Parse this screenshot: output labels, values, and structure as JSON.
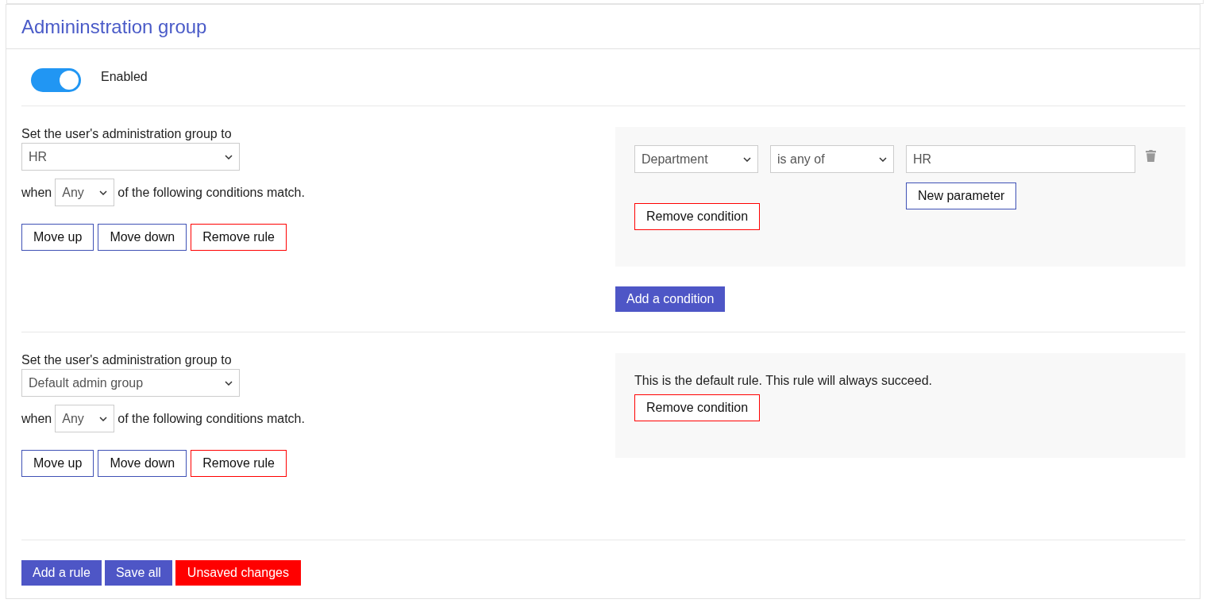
{
  "panel": {
    "title": "Admininstration group"
  },
  "enabled": {
    "label": "Enabled",
    "on": true
  },
  "rules": [
    {
      "kind": "conditions",
      "set_label": "Set the user's administration group to",
      "group": "HR",
      "when_label": "when",
      "match": "Any",
      "match_suffix": "of the following conditions match.",
      "buttons": {
        "move_up": "Move up",
        "move_down": "Move down",
        "remove": "Remove rule"
      },
      "conditions": [
        {
          "field": "Department",
          "operator": "is any of",
          "parameters": [
            "HR"
          ],
          "new_parameter": "New parameter",
          "remove": "Remove condition"
        }
      ],
      "add_condition": "Add a condition"
    },
    {
      "kind": "default",
      "set_label": "Set the user's administration group to",
      "group": "Default admin group",
      "when_label": "when",
      "match": "Any",
      "match_suffix": "of the following conditions match.",
      "buttons": {
        "move_up": "Move up",
        "move_down": "Move down",
        "remove": "Remove rule"
      },
      "default_text": "This is the default rule. This rule will always succeed.",
      "remove_condition": "Remove condition"
    }
  ],
  "footer": {
    "add_rule": "Add a rule",
    "save_all": "Save all",
    "status": "Unsaved changes"
  }
}
